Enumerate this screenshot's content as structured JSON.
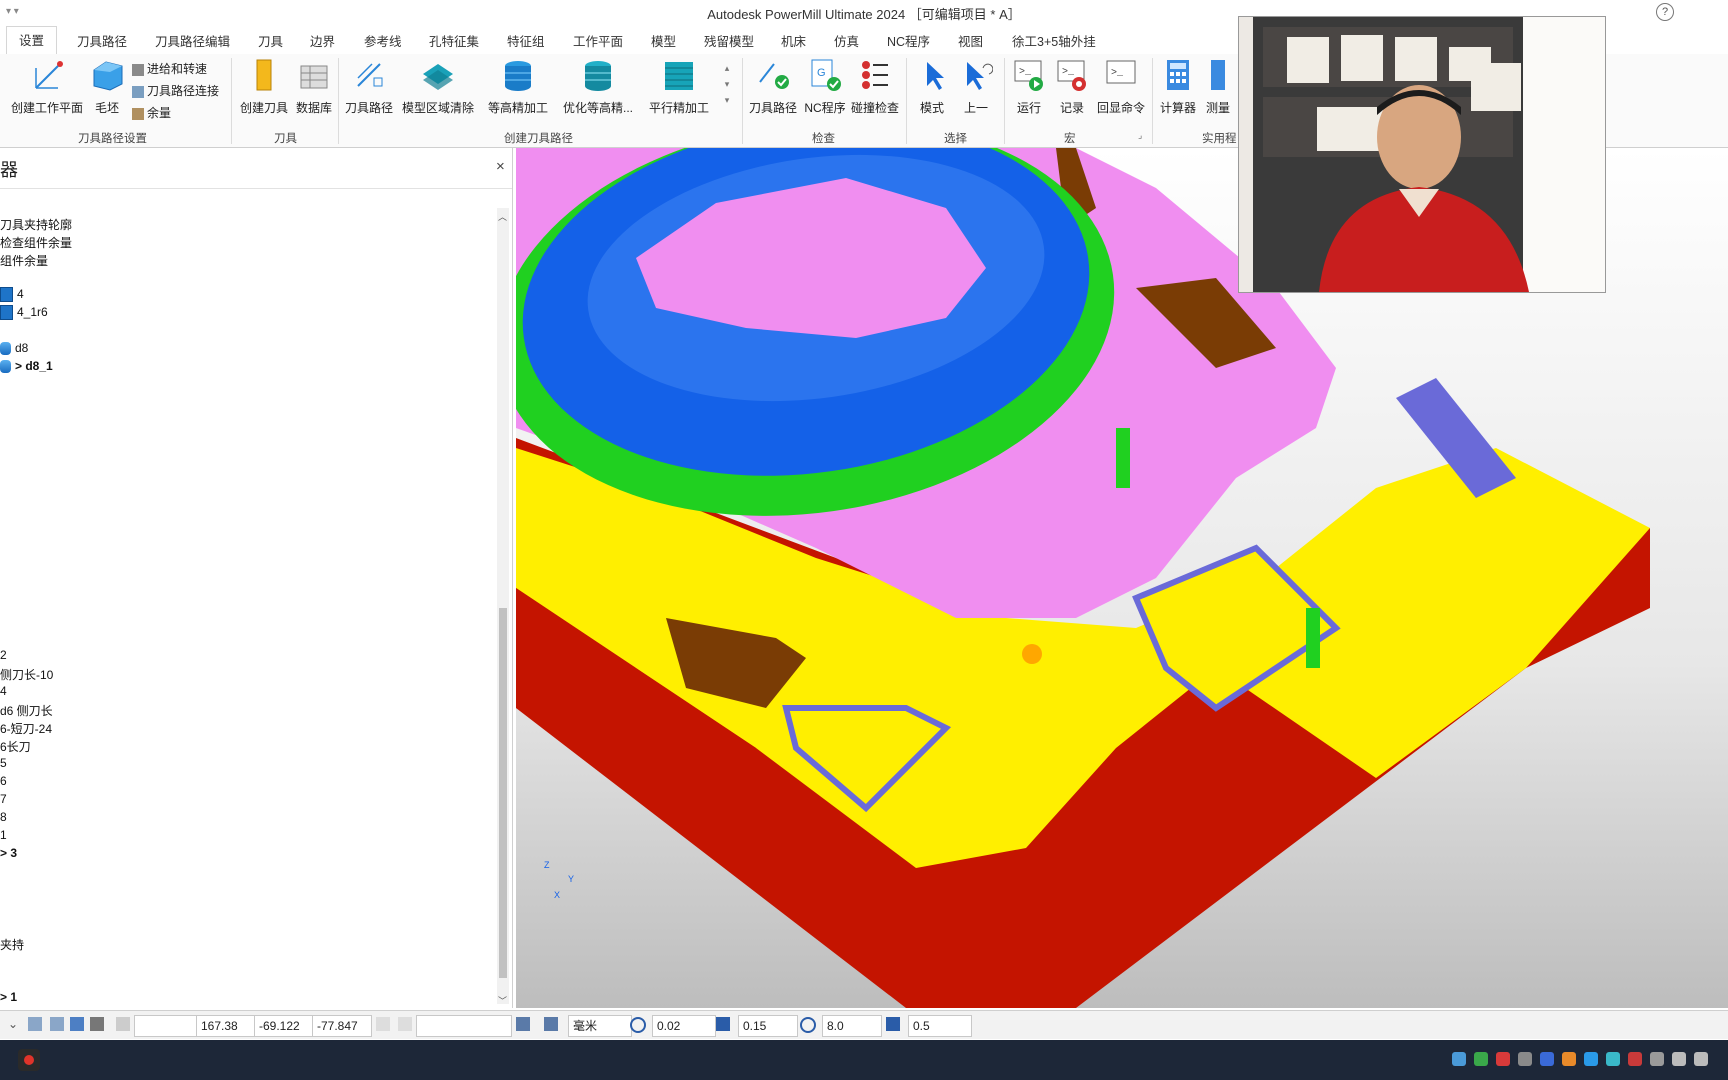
{
  "window": {
    "title": "Autodesk PowerMill Ultimate 2024 ［可编辑项目 * A］",
    "help_icon": "?"
  },
  "ribbon_tabs": [
    "设置",
    "刀具路径",
    "刀具路径编辑",
    "刀具",
    "边界",
    "参考线",
    "孔特征集",
    "特征组",
    "工作平面",
    "模型",
    "残留模型",
    "机床",
    "仿真",
    "NC程序",
    "视图",
    "徐工3+5轴外挂"
  ],
  "ribbon": {
    "group1": {
      "label": "刀具路径设置",
      "buttons": [
        "创建工作平面",
        "毛坯"
      ],
      "small_items": [
        "进给和转速",
        "刀具路径连接",
        "余量"
      ]
    },
    "group2": {
      "label": "刀具",
      "buttons": [
        "创建刀具",
        "数据库"
      ]
    },
    "group3": {
      "label": "创建刀具路径",
      "buttons": [
        "刀具路径",
        "模型区域清除",
        "等高精加工",
        "优化等高精...",
        "平行精加工"
      ]
    },
    "group4": {
      "label": "检查",
      "buttons": [
        "刀具路径",
        "NC程序",
        "碰撞检查"
      ]
    },
    "group5": {
      "label": "选择",
      "buttons": [
        "模式",
        "上一"
      ]
    },
    "group6": {
      "label": "宏",
      "buttons": [
        "运行",
        "记录",
        "回显命令"
      ]
    },
    "group7": {
      "label": "实用程",
      "buttons": [
        "计算器",
        "测量"
      ]
    }
  },
  "explorer": {
    "title": "器",
    "close": "×",
    "items": [
      {
        "text": "刀具夹持轮廓",
        "type": "text",
        "bold": false
      },
      {
        "text": "检查组件余量",
        "type": "text",
        "bold": false
      },
      {
        "text": "组件余量",
        "type": "text",
        "bold": false
      },
      {
        "text": "4",
        "type": "square",
        "bold": false
      },
      {
        "text": "4_1r6",
        "type": "square",
        "bold": false
      },
      {
        "text": "d8",
        "type": "cyl",
        "bold": false
      },
      {
        "text": "> d8_1",
        "type": "cyl",
        "bold": true
      },
      {
        "text": "2",
        "type": "text",
        "bold": false
      },
      {
        "text": "侧刀长-10",
        "type": "text",
        "bold": false
      },
      {
        "text": "4",
        "type": "text",
        "bold": false
      },
      {
        "text": "d6 侧刀长",
        "type": "text",
        "bold": false
      },
      {
        "text": "6-短刀-24",
        "type": "text",
        "bold": false
      },
      {
        "text": "6长刀",
        "type": "text",
        "bold": false
      },
      {
        "text": "5",
        "type": "text",
        "bold": false
      },
      {
        "text": "6",
        "type": "text",
        "bold": false
      },
      {
        "text": "7",
        "type": "text",
        "bold": false
      },
      {
        "text": "8",
        "type": "text",
        "bold": false
      },
      {
        "text": "1",
        "type": "text",
        "bold": false
      },
      {
        "text": "> 3",
        "type": "text",
        "bold": true
      },
      {
        "text": "夹持",
        "type": "text",
        "bold": false
      },
      {
        "text": "> 1",
        "type": "text",
        "bold": true
      }
    ]
  },
  "viewport": {
    "colors": {
      "pink": "#f08ef0",
      "blue": "#1461e8",
      "green": "#20d020",
      "yellow": "#ffef00",
      "red": "#c41400",
      "brown": "#7a3c05",
      "lilac": "#6a6ad8"
    },
    "axis_label_x": "X",
    "axis_label_y": "Y",
    "axis_label_z": "Z"
  },
  "statusbar": {
    "x": "167.38",
    "y": "-69.122",
    "z": "-77.847",
    "units": "毫米",
    "tolerance": "0.02",
    "thickness": "0.15",
    "diameter": "8.0",
    "step": "0.5"
  }
}
